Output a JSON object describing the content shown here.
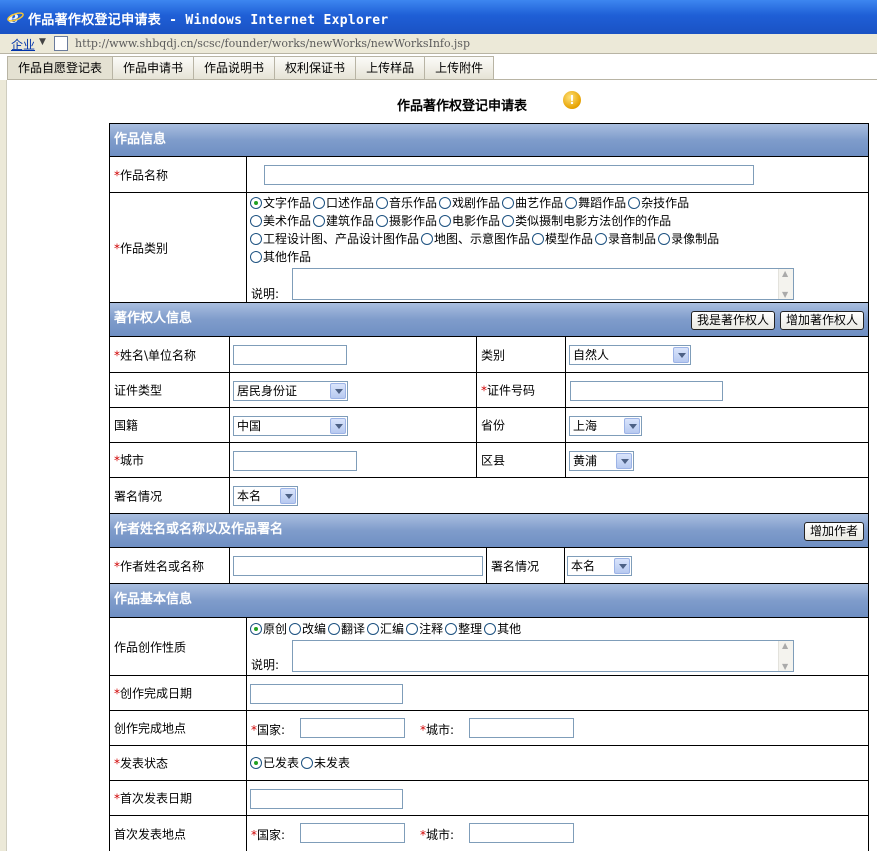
{
  "window": {
    "title": "作品著作权登记申请表 - Windows Internet Explorer"
  },
  "addressbar": {
    "zone": "企业",
    "url": "http://www.shbqdj.cn/scsc/founder/works/newWorks/newWorksInfo.jsp"
  },
  "tabs": [
    "作品自愿登记表",
    "作品申请书",
    "作品说明书",
    "权利保证书",
    "上传样品",
    "上传附件"
  ],
  "page": {
    "title": "作品著作权登记申请表"
  },
  "icons": {
    "browser": "ie-logo-icon",
    "warning": "warning-icon"
  },
  "required_mark": "*",
  "colors": {
    "section_header": "#7f9ccb",
    "required": "#d00000",
    "radio_selected": "#21a121"
  },
  "sections": {
    "work_info": {
      "title": "作品信息",
      "name_label": "作品名称",
      "type_label": "作品类别",
      "types": [
        [
          "文字作品",
          "口述作品",
          "音乐作品",
          "戏剧作品",
          "曲艺作品",
          "舞蹈作品",
          "杂技作品"
        ],
        [
          "美术作品",
          "建筑作品",
          "摄影作品",
          "电影作品",
          "类似摄制电影方法创作的作品"
        ],
        [
          "工程设计图、产品设计图作品",
          "地图、示意图作品",
          "模型作品",
          "录音制品",
          "录像制品"
        ],
        [
          "其他作品"
        ]
      ],
      "selected_type": "文字作品",
      "note_label": "说明:"
    },
    "owner_info": {
      "title": "著作权人信息",
      "btn_me": "我是著作权人",
      "btn_add": "增加著作权人",
      "name_label": "姓名\\单位名称",
      "category_label": "类别",
      "category_value": "自然人",
      "id_type_label": "证件类型",
      "id_type_value": "居民身份证",
      "id_no_label": "证件号码",
      "nation_label": "国籍",
      "nation_value": "中国",
      "province_label": "省份",
      "province_value": "上海",
      "city_label": "城市",
      "district_label": "区县",
      "district_value": "黄浦",
      "sign_label": "署名情况",
      "sign_value": "本名"
    },
    "author_info": {
      "title": "作者姓名或名称以及作品署名",
      "btn_add": "增加作者",
      "name_label": "作者姓名或名称",
      "sign_label": "署名情况",
      "sign_value": "本名"
    },
    "basic_info": {
      "title": "作品基本信息",
      "nature_label": "作品创作性质",
      "natures": [
        "原创",
        "改编",
        "翻译",
        "汇编",
        "注释",
        "整理",
        "其他"
      ],
      "selected_nature": "原创",
      "note_label": "说明:",
      "finish_date_label": "创作完成日期",
      "finish_place_label": "创作完成地点",
      "country_label": "国家:",
      "city_label": "城市:",
      "publish_state_label": "发表状态",
      "publish_options": [
        "已发表",
        "未发表"
      ],
      "selected_publish": "已发表",
      "first_pub_date_label": "首次发表日期",
      "first_pub_place_label": "首次发表地点"
    }
  }
}
